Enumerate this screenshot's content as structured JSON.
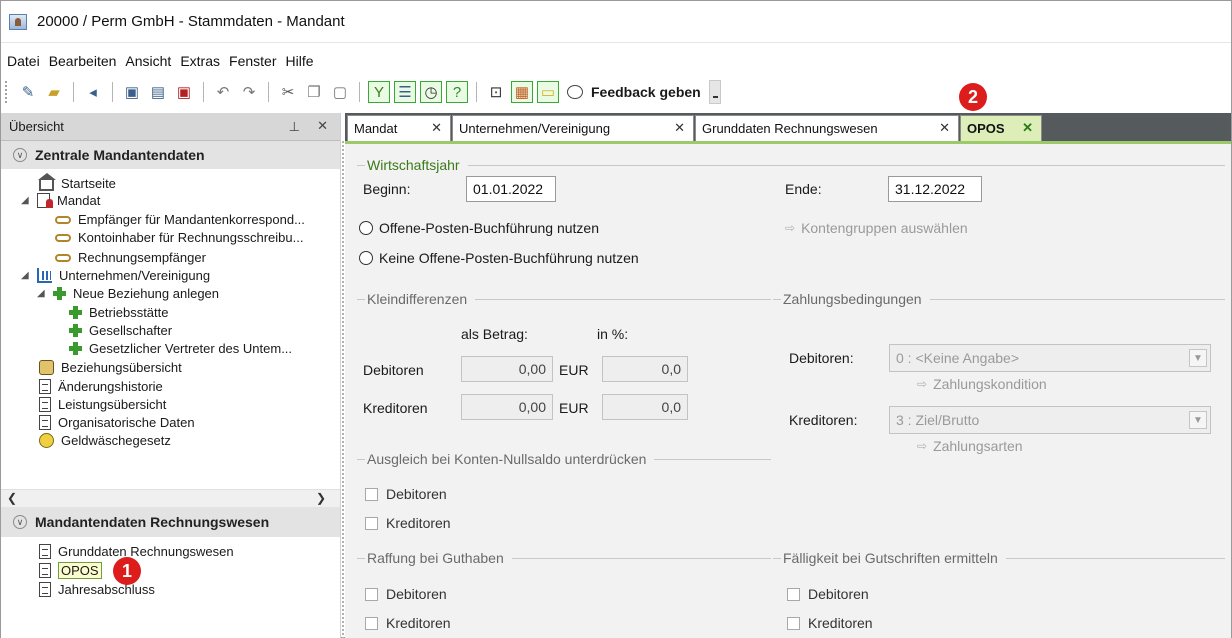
{
  "window": {
    "title": "20000 / Perm GmbH - Stammdaten - Mandant"
  },
  "menu": [
    "Datei",
    "Bearbeiten",
    "Ansicht",
    "Extras",
    "Fenster",
    "Hilfe"
  ],
  "toolbar": {
    "feedback_label": "Feedback geben",
    "buttons": [
      "new-icon",
      "open-icon",
      "back-icon",
      "save-icon",
      "save-all-icon",
      "delete-icon",
      "undo-icon",
      "redo-icon",
      "cut-icon",
      "copy-icon",
      "paste-icon",
      "tree-icon",
      "list-icon",
      "clock-icon",
      "help-icon",
      "id-card-icon",
      "report-icon",
      "note-icon",
      "speech-bubble-icon"
    ]
  },
  "left_pane": {
    "header": "Übersicht",
    "section1": "Zentrale Mandantendaten",
    "items": [
      "Startseite",
      "Mandat",
      "Empfänger für Mandantenkorrespond...",
      "Kontoinhaber für Rechnungsschreibu...",
      "Rechnungsempfänger",
      "Unternehmen/Vereinigung",
      "Neue Beziehung anlegen",
      "Betriebsstätte",
      "Gesellschafter",
      "Gesetzlicher Vertreter des Untem...",
      "Beziehungsübersicht",
      "Änderungshistorie",
      "Leistungsübersicht",
      "Organisatorische Daten",
      "Geldwäschegesetz"
    ],
    "section2": "Mandantendaten Rechnungswesen",
    "items2": [
      "Grunddaten Rechnungswesen",
      "OPOS",
      "Jahresabschluss"
    ]
  },
  "badges": {
    "left": "1",
    "tab": "2"
  },
  "tabs": [
    {
      "label": "Mandat",
      "active": false
    },
    {
      "label": "Unternehmen/Vereinigung",
      "active": false
    },
    {
      "label": "Grunddaten Rechnungswesen",
      "active": false
    },
    {
      "label": "OPOS",
      "active": true
    }
  ],
  "form": {
    "wirtschaftsjahr": {
      "group": "Wirtschaftsjahr",
      "beginn_label": "Beginn:",
      "beginn_value": "01.01.2022",
      "ende_label": "Ende:",
      "ende_value": "31.12.2022"
    },
    "radio_opos": "Offene-Posten-Buchführung nutzen",
    "radio_no_opos": "Keine Offene-Posten-Buchführung nutzen",
    "kontengruppen_link": "Kontengruppen auswählen",
    "kleindifferenzen": {
      "group": "Kleindifferenzen",
      "col_betrag": "als Betrag:",
      "col_prozent": "in %:",
      "debitoren_label": "Debitoren",
      "debitoren_betrag": "0,00",
      "debitoren_prozent": "0,0",
      "kreditoren_label": "Kreditoren",
      "kreditoren_betrag": "0,00",
      "kreditoren_prozent": "0,0",
      "currency": "EUR"
    },
    "zahlungsbedingungen": {
      "group": "Zahlungsbedingungen",
      "debitoren_label": "Debitoren:",
      "debitoren_value": "0 : <Keine Angabe>",
      "zahlungskondition_link": "Zahlungskondition",
      "kreditoren_label": "Kreditoren:",
      "kreditoren_value": "3 : Ziel/Brutto",
      "zahlungsarten_link": "Zahlungsarten"
    },
    "ausgleich": {
      "group": "Ausgleich bei Konten-Nullsaldo unterdrücken",
      "debitoren": "Debitoren",
      "kreditoren": "Kreditoren"
    },
    "raffung": {
      "group": "Raffung bei Guthaben",
      "debitoren": "Debitoren",
      "kreditoren": "Kreditoren"
    },
    "faelligkeit": {
      "group": "Fälligkeit bei Gutschriften ermitteln",
      "debitoren": "Debitoren",
      "kreditoren": "Kreditoren"
    }
  },
  "colors": {
    "tab_active_bg": "#ddeeb8",
    "tab_accent": "#9dc96a",
    "badge": "#dd1c1c",
    "tabbar_bg": "#555a5c"
  }
}
